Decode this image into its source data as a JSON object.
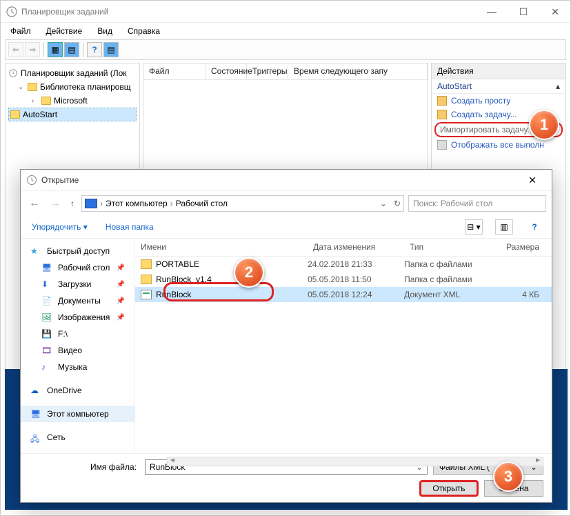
{
  "main": {
    "title": "Планировщик заданий",
    "menu": [
      "Файл",
      "Действие",
      "Вид",
      "Справка"
    ],
    "tree": {
      "root": "Планировщик заданий (Лок",
      "lib": "Библиотека планировщ",
      "ms": "Microsoft",
      "auto": "AutoStart"
    },
    "mid_cols": [
      "Файл",
      "Состояние",
      "Триггеры",
      "Время следующего запу"
    ],
    "actions": {
      "title": "Действия",
      "sub": "AutoStart",
      "items": [
        "Создать просту",
        "Создать задачу...",
        "Импортировать задачу...",
        "Отображать все выполн"
      ]
    }
  },
  "dlg": {
    "title": "Открытие",
    "crumbs": [
      "Этот компьютер",
      "Рабочий стол"
    ],
    "search_ph": "Поиск: Рабочий стол",
    "tools": {
      "org": "Упорядочить",
      "newf": "Новая папка"
    },
    "sidebar": {
      "quick": "Быстрый доступ",
      "desk": "Рабочий стол",
      "dl": "Загрузки",
      "doc": "Документы",
      "img": "Изображения",
      "drv": "F:\\",
      "vid": "Видео",
      "mus": "Музыка",
      "one": "OneDrive",
      "pc": "Этот компьютер",
      "net": "Сеть"
    },
    "cols": {
      "name": "Имени",
      "date": "Дата изменения",
      "type": "Тип",
      "size": "Размера"
    },
    "rows": [
      {
        "name": "PORTABLE",
        "date": "24.02.2018 21:33",
        "type": "Папка с файлами",
        "size": "",
        "kind": "folder"
      },
      {
        "name": "RunBlock_v1.4",
        "date": "05.05.2018 11:50",
        "type": "Папка с файлами",
        "size": "",
        "kind": "folder"
      },
      {
        "name": "RunBlock",
        "date": "05.05.2018 12:24",
        "type": "Документ XML",
        "size": "4 КБ",
        "kind": "xml"
      }
    ],
    "fn_label": "Имя файла:",
    "fn_value": "RunBlock",
    "filter": "Файлы XML (",
    "open": "Открыть",
    "cancel": "Отмена"
  }
}
